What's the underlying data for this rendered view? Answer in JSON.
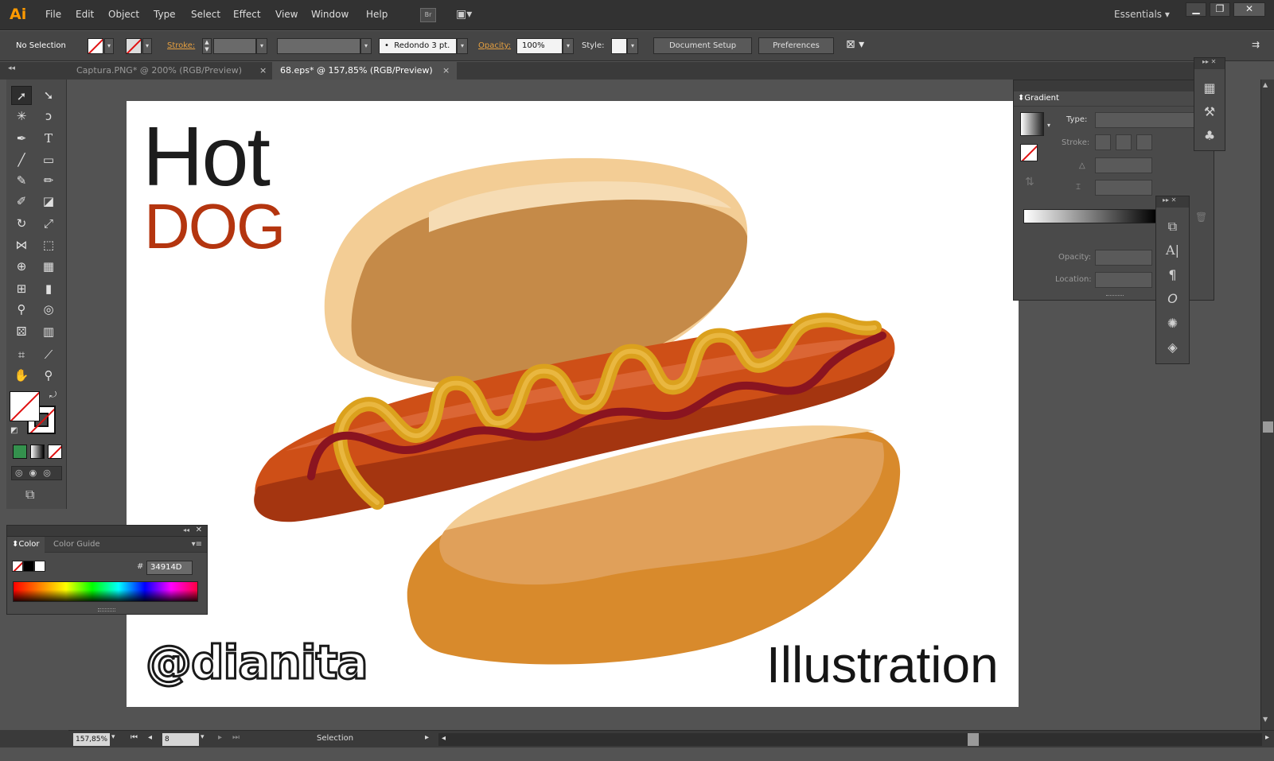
{
  "app": {
    "logo": "Ai"
  },
  "menu": [
    "File",
    "Edit",
    "Object",
    "Type",
    "Select",
    "Effect",
    "View",
    "Window",
    "Help"
  ],
  "bridge_label": "Br",
  "workspace": {
    "label": "Essentials"
  },
  "window_controls": {
    "minimize": "▁",
    "restore": "❐",
    "close": "✕"
  },
  "control_bar": {
    "selection_status": "No Selection",
    "stroke_label": "Stroke:",
    "brush_label": "Redondo 3 pt.",
    "opacity_label": "Opacity:",
    "opacity_value": "100%",
    "style_label": "Style:",
    "document_setup": "Document Setup",
    "preferences": "Preferences"
  },
  "tabs": [
    {
      "label": "Captura.PNG* @ 200% (RGB/Preview)",
      "active": false
    },
    {
      "label": "68.eps* @ 157,85% (RGB/Preview)",
      "active": true
    }
  ],
  "tab_close": "×",
  "tools": [
    {
      "name": "selection-tool",
      "glyph": "➚"
    },
    {
      "name": "direct-selection-tool",
      "glyph": "➘"
    },
    {
      "name": "magic-wand-tool",
      "glyph": "✳"
    },
    {
      "name": "lasso-tool",
      "glyph": "ↄ"
    },
    {
      "name": "pen-tool",
      "glyph": "✒"
    },
    {
      "name": "type-tool",
      "glyph": "T"
    },
    {
      "name": "line-tool",
      "glyph": "╱"
    },
    {
      "name": "rectangle-tool",
      "glyph": "▭"
    },
    {
      "name": "paintbrush-tool",
      "glyph": "✎"
    },
    {
      "name": "pencil-tool",
      "glyph": "✏"
    },
    {
      "name": "blob-brush-tool",
      "glyph": "✐"
    },
    {
      "name": "eraser-tool",
      "glyph": "◪"
    },
    {
      "name": "rotate-tool",
      "glyph": "↻"
    },
    {
      "name": "scale-tool",
      "glyph": "⤢"
    },
    {
      "name": "width-tool",
      "glyph": "⋈"
    },
    {
      "name": "free-transform-tool",
      "glyph": "⬚"
    },
    {
      "name": "shape-builder-tool",
      "glyph": "⊕"
    },
    {
      "name": "perspective-grid-tool",
      "glyph": "▦"
    },
    {
      "name": "mesh-tool",
      "glyph": "⊞"
    },
    {
      "name": "gradient-tool",
      "glyph": "▮"
    },
    {
      "name": "eyedropper-tool",
      "glyph": "⚲"
    },
    {
      "name": "blend-tool",
      "glyph": "◎"
    },
    {
      "name": "symbol-sprayer-tool",
      "glyph": "⚄"
    },
    {
      "name": "column-graph-tool",
      "glyph": "▥"
    },
    {
      "name": "artboard-tool",
      "glyph": "⌗"
    },
    {
      "name": "slice-tool",
      "glyph": "⟋"
    },
    {
      "name": "hand-tool",
      "glyph": "✋"
    },
    {
      "name": "zoom-tool",
      "glyph": "⚲"
    }
  ],
  "artwork": {
    "title_line1": "Hot",
    "title_line2": "DOG",
    "handle": "@dianita",
    "caption": "Illustration"
  },
  "color_panel": {
    "tab_color": "Color",
    "tab_color_guide": "Color Guide",
    "hex_label": "#",
    "hex_value": "34914D"
  },
  "gradient_panel": {
    "title": "Gradient",
    "type_label": "Type:",
    "stroke_label": "Stroke:",
    "opacity_label": "Opacity:",
    "location_label": "Location:"
  },
  "status_bar": {
    "zoom": "157,85%",
    "page": "8",
    "tool": "Selection"
  },
  "colors": {
    "accent_orange": "#ff9a00",
    "title_dark": "#1c1c1c",
    "dog_red": "#b4350f",
    "fill_green": "#34914D"
  }
}
